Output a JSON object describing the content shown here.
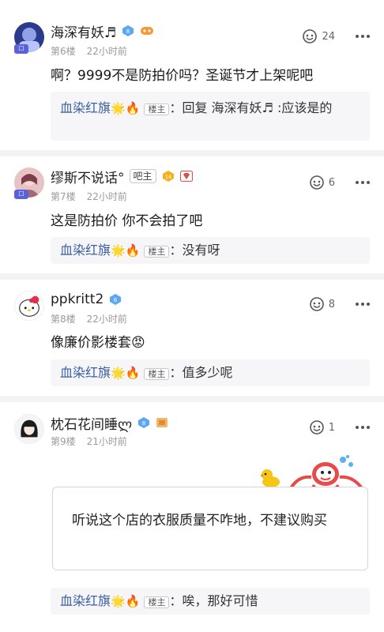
{
  "posts": [
    {
      "username": "海深有妖♬",
      "level": "8",
      "floor": "第6楼",
      "time": "22小时前",
      "likes": "24",
      "content": "啊？9999不是防拍价吗？圣诞节才上架呢吧",
      "reply": {
        "name": "血染红旗",
        "emoji": "🌟🔥",
        "tag": "楼主",
        "text": "：回复 海深有妖♬ :应该是的"
      }
    },
    {
      "username": "缪斯不说话°",
      "tag": "吧主",
      "level": "14",
      "floor": "第7楼",
      "time": "22小时前",
      "likes": "6",
      "content": "这是防拍价 你不会拍了吧",
      "reply": {
        "name": "血染红旗",
        "emoji": "🌟🔥",
        "tag": "楼主",
        "text": "：没有呀"
      }
    },
    {
      "username": "ppkritt2",
      "level": "6",
      "floor": "第8楼",
      "time": "22小时前",
      "likes": "8",
      "content": "像廉价影楼套😡",
      "reply": {
        "name": "血染红旗",
        "emoji": "🌟🔥",
        "tag": "楼主",
        "text": "：值多少呢"
      }
    },
    {
      "username": "枕石花间睡ლ",
      "level": "8",
      "floor": "第9楼",
      "time": "21小时前",
      "likes": "1",
      "content": "听说这个店的衣服质量不咋地，不建议购买",
      "reply": {
        "name": "血染红旗",
        "emoji": "🌟🔥",
        "tag": "楼主",
        "text": "：唉，那好可惜"
      }
    }
  ],
  "colors": {
    "accent": "#3a5fa5",
    "badge_blue": "#4a8df0",
    "divider": "#f3f3f5"
  }
}
